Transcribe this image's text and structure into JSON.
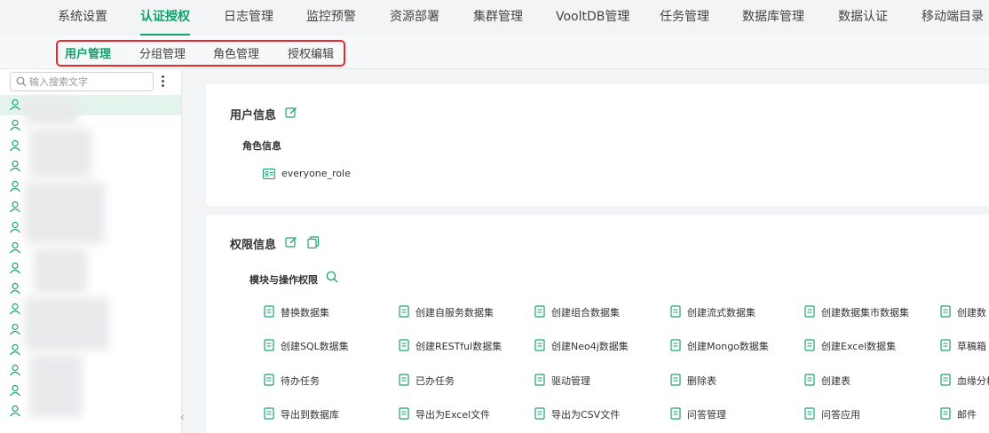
{
  "colors": {
    "accent": "#0fa36b",
    "highlight_box": "#e8282d",
    "icon": "#1aa36f"
  },
  "topnav": {
    "items": [
      {
        "label": "系统设置"
      },
      {
        "label": "认证授权"
      },
      {
        "label": "日志管理"
      },
      {
        "label": "监控预警"
      },
      {
        "label": "资源部署"
      },
      {
        "label": "集群管理"
      },
      {
        "label": "VooltDB管理"
      },
      {
        "label": "任务管理"
      },
      {
        "label": "数据库管理"
      },
      {
        "label": "数据认证"
      },
      {
        "label": "移动端目录"
      }
    ],
    "active": "认证授权"
  },
  "subnav": {
    "items": [
      {
        "label": "用户管理"
      },
      {
        "label": "分组管理"
      },
      {
        "label": "角色管理"
      },
      {
        "label": "授权编辑"
      }
    ],
    "active": "用户管理"
  },
  "sidebar": {
    "search_placeholder": "输入搜索文字",
    "user_count_visible": 16
  },
  "user_info": {
    "title": "用户信息",
    "role_section_title": "角色信息",
    "roles": [
      {
        "name": "everyone_role",
        "icon": "id-card-icon"
      }
    ]
  },
  "permission_info": {
    "title": "权限信息",
    "module_section_title": "模块与操作权限",
    "items": [
      {
        "label": "替换数据集",
        "icon": "replace-dataset-icon"
      },
      {
        "label": "创建自服务数据集",
        "icon": "self-service-dataset-icon"
      },
      {
        "label": "创建组合数据集",
        "icon": "combined-dataset-icon"
      },
      {
        "label": "创建流式数据集",
        "icon": "stream-dataset-icon"
      },
      {
        "label": "创建数据集市数据集",
        "icon": "datamart-dataset-icon"
      },
      {
        "label": "创建数",
        "icon": "network-dataset-icon"
      },
      {
        "label": "创建SQL数据集",
        "icon": "sql-dataset-icon"
      },
      {
        "label": "创建RESTful数据集",
        "icon": "restful-dataset-icon"
      },
      {
        "label": "创建Neo4j数据集",
        "icon": "neo4j-dataset-icon"
      },
      {
        "label": "创建Mongo数据集",
        "icon": "mongo-dataset-icon"
      },
      {
        "label": "创建Excel数据集",
        "icon": "excel-dataset-icon"
      },
      {
        "label": "草稿箱",
        "icon": "drafts-icon"
      },
      {
        "label": "待办任务",
        "icon": "todo-task-icon"
      },
      {
        "label": "已办任务",
        "icon": "done-task-icon"
      },
      {
        "label": "驱动管理",
        "icon": "driver-settings-icon"
      },
      {
        "label": "删除表",
        "icon": "delete-table-icon"
      },
      {
        "label": "创建表",
        "icon": "create-table-icon"
      },
      {
        "label": "血缘分析",
        "icon": "lineage-icon"
      },
      {
        "label": "导出到数据库",
        "icon": "export-database-icon"
      },
      {
        "label": "导出为Excel文件",
        "icon": "export-excel-icon"
      },
      {
        "label": "导出为CSV文件",
        "icon": "export-csv-icon"
      },
      {
        "label": "问答管理",
        "icon": "qa-manage-icon"
      },
      {
        "label": "问答应用",
        "icon": "qa-app-icon"
      },
      {
        "label": "邮件",
        "icon": "mail-icon"
      }
    ]
  }
}
